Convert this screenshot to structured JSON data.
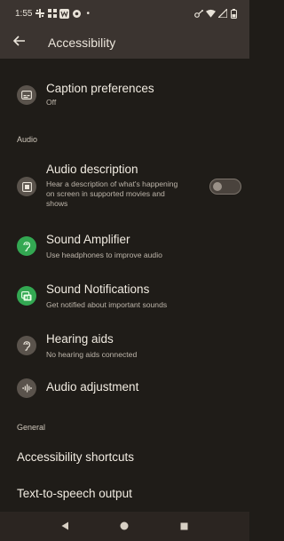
{
  "status_bar": {
    "time": "1:55",
    "dot": "•",
    "icons_left": [
      "grid-icon",
      "grid-dots-icon",
      "w-app-icon",
      "gear-icon"
    ],
    "icons_right": [
      "vpn-key-icon",
      "wifi-icon",
      "signal-icon",
      "battery-icon"
    ]
  },
  "app_bar": {
    "title": "Accessibility",
    "back_icon": "arrow-back-icon"
  },
  "items": {
    "caption": {
      "title": "Caption preferences",
      "subtitle": "Off",
      "icon": "captions-icon",
      "icon_bg": "#5a534c"
    },
    "audio_description": {
      "title": "Audio description",
      "subtitle_lines": [
        "Hear a description of what's happening",
        "on screen in supported movies and",
        "shows"
      ],
      "icon": "audio-description-icon",
      "icon_bg": "#5a534c",
      "toggle_on": false
    },
    "sound_amplifier": {
      "title": "Sound Amplifier",
      "subtitle": "Use headphones to improve audio",
      "icon": "ear-amplifier-icon",
      "icon_bg": "#33a852"
    },
    "sound_notifications": {
      "title": "Sound Notifications",
      "subtitle": "Get notified about important sounds",
      "icon": "sound-notification-icon",
      "icon_bg": "#33a852"
    },
    "hearing_aids": {
      "title": "Hearing aids",
      "subtitle": "No hearing aids connected",
      "icon": "hearing-icon",
      "icon_bg": "#5a534c"
    },
    "audio_adjustment": {
      "title": "Audio adjustment",
      "icon": "equalizer-icon",
      "icon_bg": "#5a534c"
    }
  },
  "sections": {
    "audio": "Audio",
    "general": "General"
  },
  "general_items": {
    "shortcuts": "Accessibility shortcuts",
    "tts": "Text-to-speech output"
  },
  "nav_bar": {
    "back": "back-triangle-icon",
    "home": "home-circle-icon",
    "recents": "recents-square-icon"
  },
  "colors": {
    "background": "#1f1c18",
    "app_bar": "#3b3430",
    "accent_green": "#33a852"
  }
}
